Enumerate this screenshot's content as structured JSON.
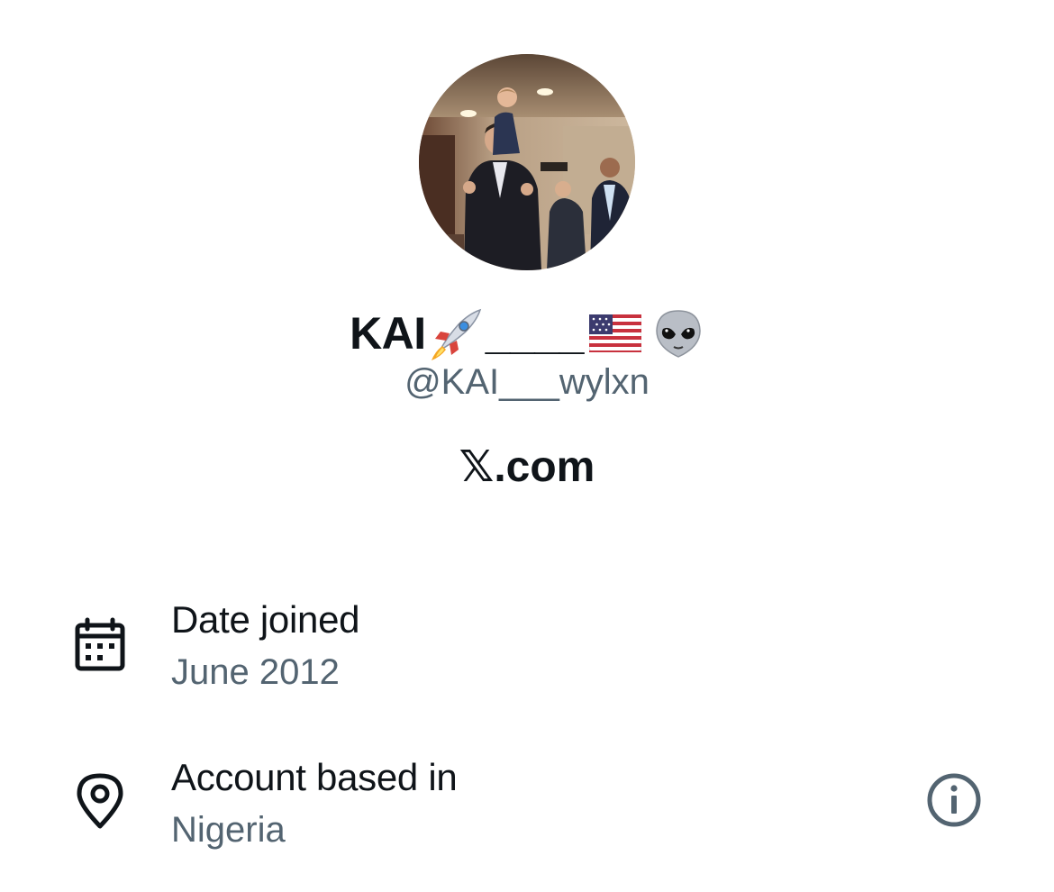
{
  "profile": {
    "display_name_text": "KAI",
    "display_name_separator": "____",
    "display_name_emojis": [
      "rocket-emoji",
      "us-flag-emoji",
      "alien-emoji"
    ],
    "handle": "@KAI___wylxn",
    "website": "𝕏.com"
  },
  "about": {
    "date_joined": {
      "icon": "calendar-icon",
      "title": "Date joined",
      "value": "June 2012"
    },
    "account_based_in": {
      "icon": "location-pin-icon",
      "title": "Account based in",
      "value": "Nigeria",
      "info_icon": "info-icon"
    }
  },
  "colors": {
    "primary_text": "#0f1419",
    "secondary_text": "#536471",
    "background": "#ffffff"
  }
}
